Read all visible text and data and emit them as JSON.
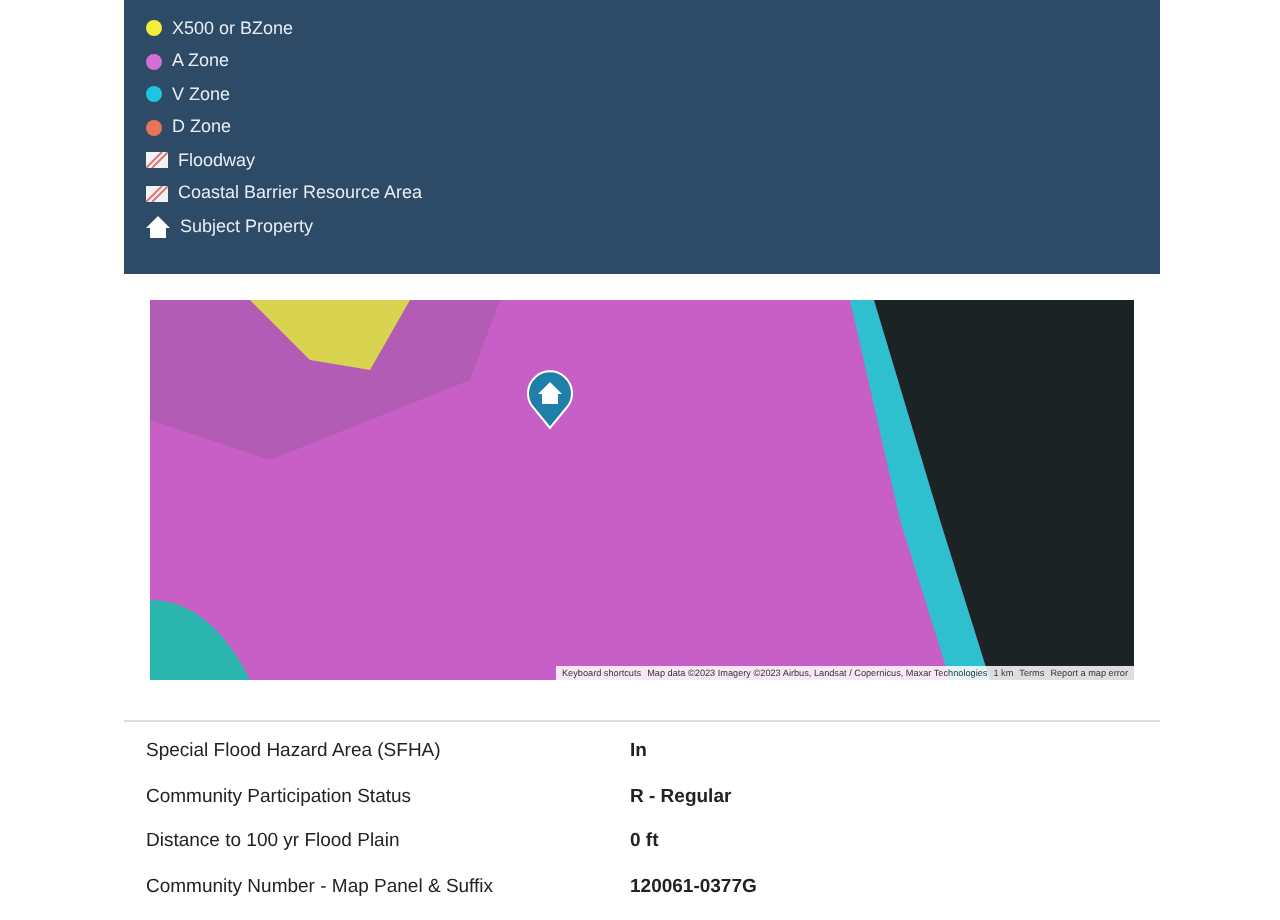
{
  "legend": {
    "items": [
      {
        "kind": "dot",
        "label": "X500 or BZone",
        "color": "#f2ee3c"
      },
      {
        "kind": "dot",
        "label": "A Zone",
        "color": "#d56fd6"
      },
      {
        "kind": "dot",
        "label": "V Zone",
        "color": "#1fc4e0"
      },
      {
        "kind": "dot",
        "label": "D Zone",
        "color": "#e8735a"
      },
      {
        "kind": "hatch",
        "label": "Floodway"
      },
      {
        "kind": "hatch",
        "label": "Coastal Barrier Resource Area"
      },
      {
        "kind": "house",
        "label": "Subject Property"
      }
    ]
  },
  "map": {
    "attribution": [
      "Keyboard shortcuts",
      "Map data ©2023 Imagery ©2023 Airbus, Landsat / Copernicus, Maxar Technologies",
      "1 km",
      "Terms",
      "Report a map error"
    ]
  },
  "details": [
    {
      "label": "Special Flood Hazard Area (SFHA)",
      "value": "In"
    },
    {
      "label": "Community Participation Status",
      "value": "R - Regular"
    },
    {
      "label": "Distance to 100 yr Flood Plain",
      "value": "0 ft"
    },
    {
      "label": "Community Number - Map Panel & Suffix",
      "value": "120061-0377G"
    }
  ]
}
